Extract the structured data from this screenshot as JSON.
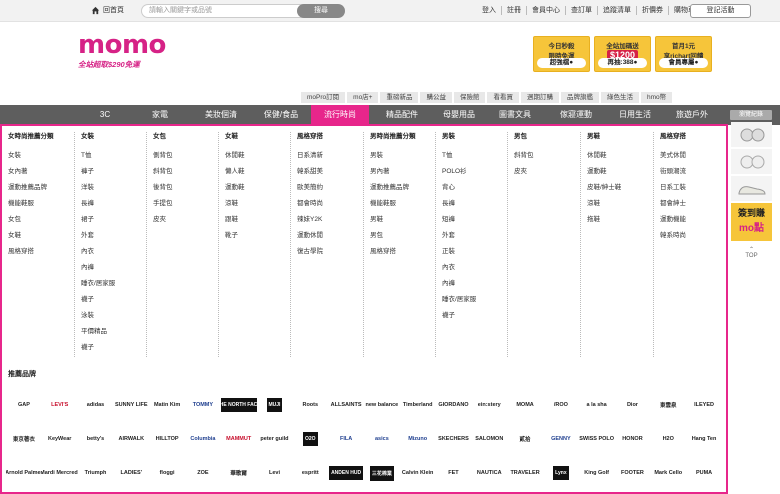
{
  "topbar": {
    "home_label": "回首頁",
    "search_placeholder": "請輸入關鍵字或品號",
    "search_button": "搜尋",
    "links": [
      "登入",
      "註冊",
      "會員中心",
      "查訂單",
      "追蹤清單",
      "折價券",
      "購物車"
    ],
    "login_event": "登記活動"
  },
  "logo": {
    "word": "momo",
    "tagline": "全站超取$290免運"
  },
  "promos": [
    {
      "line1": "今日秒殺",
      "line2": "限時免運",
      "bottom": "超強檔●"
    },
    {
      "line1": "全站加碼送",
      "big": "$1200",
      "bottom": "再抽:388●"
    },
    {
      "line1": "首月1元",
      "line2": "享richart回饋",
      "bottom": "會員專屬●"
    }
  ],
  "subnav": [
    "moPro訂閱",
    "mo店+",
    "重磅新品",
    "購公益",
    "保險館",
    "看看買",
    "週期訂購",
    "品牌旗艦",
    "綠色生活",
    "hmo幣"
  ],
  "mainnav": [
    "3C",
    "家電",
    "美妝個清",
    "保健/食品",
    "流行時尚",
    "精品配件",
    "母嬰用品",
    "圖書文具",
    "傢寢運動",
    "日用生活",
    "旅遊戶外"
  ],
  "browse_label": "瀏覽紀錄",
  "columns": [
    {
      "header": "女時尚推薦分類",
      "items": [
        "女裝",
        "女內著",
        "運動推薦品牌",
        "機能鞋服",
        "女包",
        "女鞋",
        "風格穿搭"
      ]
    },
    {
      "header": "女裝",
      "items": [
        "T恤",
        "褲子",
        "洋裝",
        "長褲",
        "裙子",
        "外套",
        "內衣",
        "內褲",
        "睡衣/居家服",
        "襪子",
        "泳裝",
        "平價精品",
        "襪子"
      ]
    },
    {
      "header": "女包",
      "items": [
        "側背包",
        "斜背包",
        "後背包",
        "手提包",
        "皮夾"
      ]
    },
    {
      "header": "女鞋",
      "items": [
        "休閒鞋",
        "懶人鞋",
        "運動鞋",
        "涼鞋",
        "跟鞋",
        "靴子"
      ]
    },
    {
      "header": "風格穿搭",
      "items": [
        "日系清新",
        "韓系甜美",
        "歐美簡約",
        "都會時尚",
        "辣妹Y2K",
        "運動休閒",
        "復古學院"
      ]
    },
    {
      "header": "男時尚推薦分類",
      "items": [
        "男裝",
        "男內著",
        "運動推薦品牌",
        "機能鞋服",
        "男鞋",
        "男包",
        "風格穿搭"
      ]
    },
    {
      "header": "男裝",
      "items": [
        "T恤",
        "POLO衫",
        "背心",
        "長褲",
        "短褲",
        "外套",
        "正裝",
        "內衣",
        "內褲",
        "睡衣/居家服",
        "襪子"
      ]
    },
    {
      "header": "男包",
      "items": [
        "斜背包",
        "皮夾"
      ]
    },
    {
      "header": "男鞋",
      "items": [
        "休閒鞋",
        "運動鞋",
        "皮鞋/紳士鞋",
        "涼鞋",
        "拖鞋"
      ]
    },
    {
      "header": "風格穿搭",
      "items": [
        "美式休閒",
        "街頭潮流",
        "日系工裝",
        "都會紳士",
        "運動機能",
        "韓系時尚"
      ]
    }
  ],
  "brands_title": "推薦品牌",
  "brands": [
    "GAP",
    "LEVI'S",
    "adidas",
    "SUNNY LIFE",
    "Matin Kim",
    "TOMMY",
    "THE NORTH FACE",
    "MUJI",
    "Roots",
    "ALLSAINTS",
    "new balance",
    "Timberland",
    "GIORDANO",
    "ein:stery",
    "MOMA",
    "/ROO",
    "a la sha",
    "Dior",
    "東雲泉",
    "ILEYED",
    "東京著衣",
    "KeyWear",
    "betty's",
    "AIRWALK",
    "HILLTOP",
    "Columbia",
    "MAMMUT",
    "peter guild",
    "O2O",
    "FILA",
    "asics",
    "Mizuno",
    "SKECHERS",
    "SALOMON",
    "貳拾",
    "GENNY",
    "SWISS POLO",
    "HONOR",
    "H2O",
    "Hang Ten",
    "Arnold Palmer",
    "Mardi Mercredi",
    "Triumph",
    "LADIES'",
    "floggi",
    "ZOE",
    "華歌爾",
    "Levi",
    "espritt",
    "ANDEN HUD",
    "三花棉業",
    "Calvin Klein",
    "FET",
    "NAUTICA",
    "TRAVELER",
    "Lynx",
    "King Golf",
    "FOOTER",
    "Mark Cello",
    "PUMA"
  ],
  "side": {
    "ad_line1": "簽到賺",
    "ad_line2": "mo點",
    "top_label": "TOP"
  }
}
